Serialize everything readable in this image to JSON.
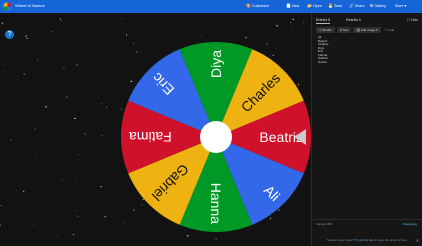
{
  "app": {
    "title": "Wheel of Names"
  },
  "menu": [
    {
      "icon": "palette-icon",
      "glyph": "🎨",
      "label": "Customize"
    },
    {
      "icon": "new-icon",
      "glyph": "📄",
      "label": "New"
    },
    {
      "icon": "open-icon",
      "glyph": "📂",
      "label": "Open"
    },
    {
      "icon": "save-icon",
      "glyph": "💾",
      "label": "Save"
    },
    {
      "icon": "share-icon",
      "glyph": "🔗",
      "label": "Share"
    },
    {
      "icon": "gallery-icon",
      "glyph": "⊞",
      "label": "Gallery"
    },
    {
      "icon": "more-icon",
      "glyph": "",
      "label": "More"
    }
  ],
  "sidebar": {
    "tab_entries": "Entries 8",
    "tab_results": "Results 0",
    "hide_label": "Hide",
    "toolbar": {
      "shuffle": "Shuffle",
      "sort": "Sort",
      "add_image": "Add image",
      "hide_checkbox": "Hide"
    },
    "entries": [
      "Ali",
      "Beatriz",
      "Charles",
      "Diya",
      "Eric",
      "Fatima",
      "Gabriel",
      "Hanna"
    ],
    "results_bar": {
      "left": "Version 305",
      "right": "Changelog"
    },
    "footnote": {
      "prefix": "Need a single wheel? ",
      "link": "Try out this site",
      "suffix": " to make the wheel for free."
    }
  },
  "wheel": {
    "slices": [
      {
        "name": "Beatriz",
        "color": "#d0112b"
      },
      {
        "name": "Ali",
        "color": "#3369e8"
      },
      {
        "name": "Hanna",
        "color": "#009925"
      },
      {
        "name": "Gabriel",
        "color": "#eeb211"
      },
      {
        "name": "Fatima",
        "color": "#d0112b"
      },
      {
        "name": "Eric",
        "color": "#3369e8"
      },
      {
        "name": "Diya",
        "color": "#009925"
      },
      {
        "name": "Charles",
        "color": "#eeb211"
      }
    ]
  }
}
